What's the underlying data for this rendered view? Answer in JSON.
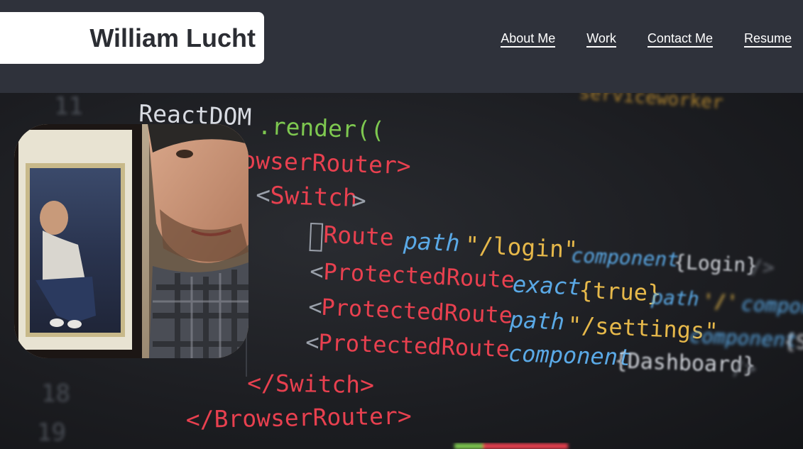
{
  "header": {
    "logo_name": "William Lucht",
    "nav": [
      {
        "label": "About Me"
      },
      {
        "label": "Work"
      },
      {
        "label": "Contact Me"
      },
      {
        "label": "Resume"
      }
    ]
  },
  "code": {
    "line_numbers": [
      "11",
      "18",
      "19"
    ],
    "lines": {
      "top_faded": "serviceworker",
      "l1_react": "ReactDOM",
      "l1_render": ".render((",
      "l2": "owserRouter>",
      "l3_open": "<",
      "l3_tag": "Switch",
      "l3_close": ">",
      "l4_tag": "Route",
      "l4_attr": "path",
      "l4_val": "\"/login\"",
      "l4_comp": "component",
      "l4_compval": "{Login}",
      "l4_end": "/>",
      "l5_tag": "ProtectedRoute",
      "l5_attr": "exact",
      "l5_val": "{true}",
      "l5_attr2": "path",
      "l5_val2": "'/'",
      "l5_comp": "compone",
      "l6_tag": "ProtectedRoute",
      "l6_attr": "path",
      "l6_val": "\"/settings\"",
      "l6_comp": "component",
      "l6_compval": "{S",
      "l7_tag": "ProtectedRoute",
      "l7_comp": "component",
      "l7_compval": "{Dashboard}",
      "l7_end": "/>",
      "l8": "</Switch>",
      "l9": "</BrowserRouter>"
    }
  },
  "colors": {
    "header_bg": "#2f323b",
    "logo_bg": "#ffffff",
    "code_bg": "#1b1d22",
    "tag_red": "#e8404f",
    "attr_blue": "#5aa9e6",
    "string_yellow": "#e6b84a",
    "bracket_grey": "#9aa0aa",
    "render_green": "#7ec850"
  }
}
